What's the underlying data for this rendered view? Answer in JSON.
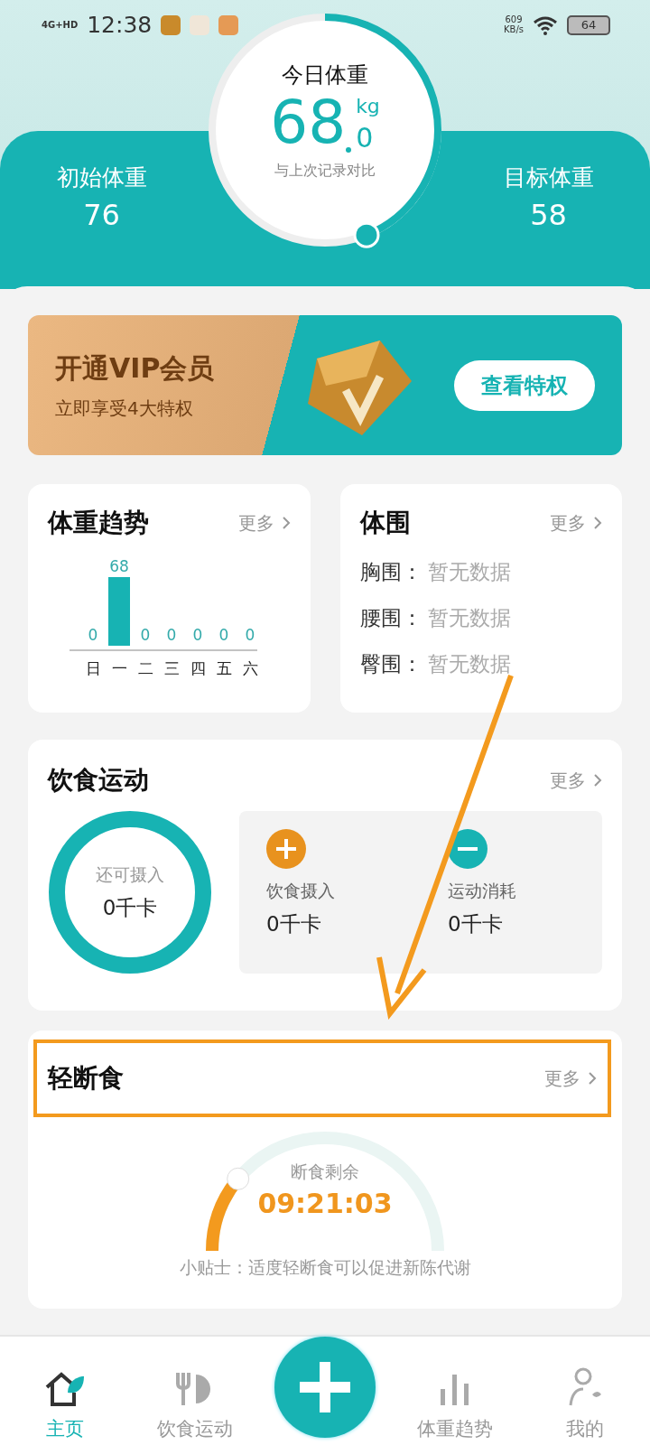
{
  "status_bar": {
    "network": "4G+HD",
    "time": "12:38",
    "speed": "609",
    "speed_unit": "KB/s",
    "battery": "64"
  },
  "today": {
    "title": "今日体重",
    "value": "68",
    "decimal": "0",
    "unit": "kg",
    "caption": "与上次记录对比"
  },
  "start_weight": {
    "label": "初始体重",
    "value": "76"
  },
  "target_weight": {
    "label": "目标体重",
    "value": "58"
  },
  "vip": {
    "title": "开通VIP会员",
    "subtitle": "立即享受4大特权",
    "button": "查看特权"
  },
  "weight_trend": {
    "title": "体重趋势",
    "more": "更多",
    "chart_data": {
      "type": "bar",
      "categories": [
        "日",
        "一",
        "二",
        "三",
        "四",
        "五",
        "六"
      ],
      "values": [
        0,
        68,
        0,
        0,
        0,
        0,
        0
      ],
      "data_labels": true
    }
  },
  "girth": {
    "title": "体围",
    "more": "更多",
    "rows": [
      {
        "label": "胸围：",
        "value": "暂无数据"
      },
      {
        "label": "腰围：",
        "value": "暂无数据"
      },
      {
        "label": "臀围：",
        "value": "暂无数据"
      }
    ]
  },
  "diet": {
    "title": "饮食运动",
    "more": "更多",
    "remaining_label": "还可摄入",
    "remaining_value": "0千卡",
    "items": [
      {
        "kind": "plus",
        "label": "饮食摄入",
        "value": "0千卡"
      },
      {
        "kind": "minus",
        "label": "运动消耗",
        "value": "0千卡"
      }
    ]
  },
  "fasting": {
    "title": "轻断食",
    "more": "更多",
    "highlighted": true,
    "label": "断食剩余",
    "time": "09:21:03",
    "tip": "小贴士：适度轻断食可以促进新陈代谢"
  },
  "annotation_arrow": true,
  "nav": [
    {
      "kind": "home",
      "label": "主页",
      "selected": true
    },
    {
      "kind": "diet",
      "label": "饮食运动",
      "selected": false
    },
    {
      "kind": "add"
    },
    {
      "kind": "chart",
      "label": "体重趋势",
      "selected": false
    },
    {
      "kind": "me",
      "label": "我的",
      "selected": false
    }
  ]
}
